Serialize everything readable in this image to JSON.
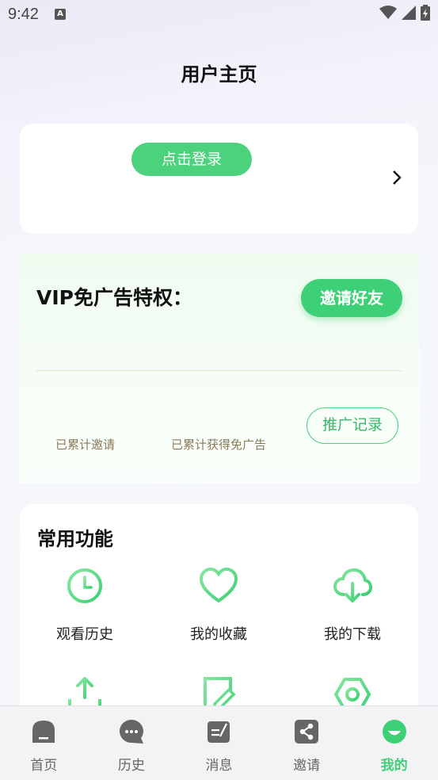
{
  "status_bar": {
    "time": "9:42",
    "notification_letter": "A"
  },
  "page_title": "用户主页",
  "login": {
    "button_label": "点击登录"
  },
  "vip": {
    "title": "VIP免广告特权：",
    "invite_button": "邀请好友",
    "promo_button": "推广记录",
    "stat_invited_label": "已累计邀请",
    "stat_adfree_label": "已累计获得免广告"
  },
  "functions": {
    "title": "常用功能",
    "items": [
      {
        "label": "观看历史",
        "icon": "clock-icon"
      },
      {
        "label": "我的收藏",
        "icon": "heart-icon"
      },
      {
        "label": "我的下载",
        "icon": "cloud-download-icon"
      }
    ]
  },
  "tabs": [
    {
      "label": "首页",
      "icon": "home-icon"
    },
    {
      "label": "历史",
      "icon": "chat-bubble-icon"
    },
    {
      "label": "消息",
      "icon": "message-icon"
    },
    {
      "label": "邀请",
      "icon": "share-icon"
    },
    {
      "label": "我的",
      "icon": "profile-icon",
      "active": true
    }
  ],
  "colors": {
    "accent": "#3ed077",
    "promo_text": "#3bb86a",
    "stat_text": "#8a7a5c"
  }
}
